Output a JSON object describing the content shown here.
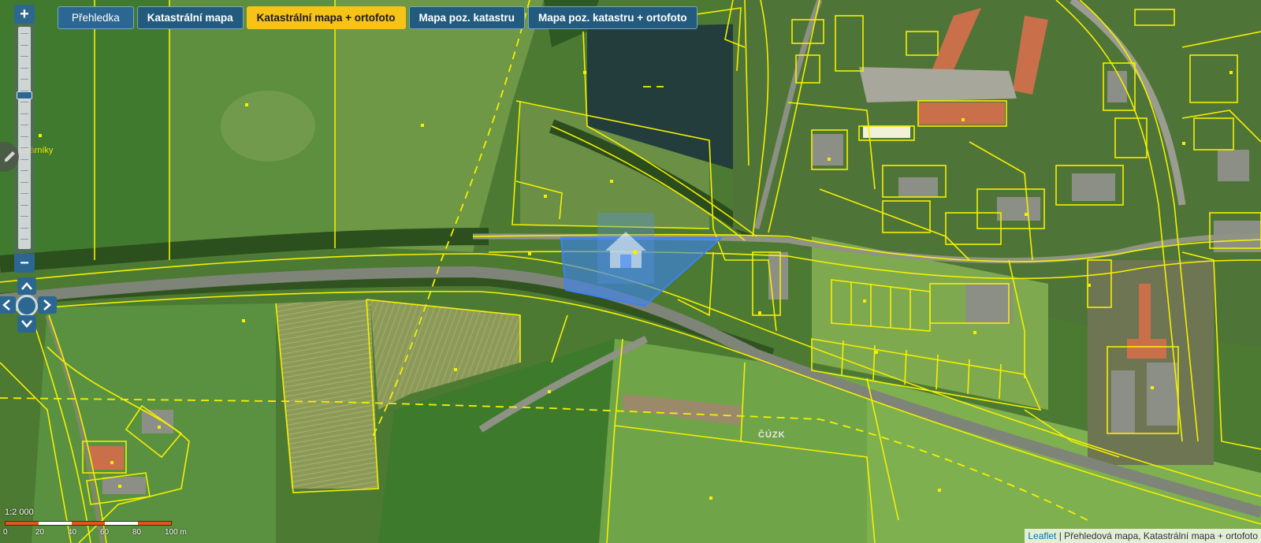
{
  "layers": {
    "overview": "Přehledka",
    "cadastral": "Katastrální mapa",
    "cadastral_ortho": "Katastrální mapa + ortofoto",
    "pos_cadastre": "Mapa poz. katastru",
    "pos_cadastre_ortho": "Mapa poz. katastru + ortofoto",
    "active": "cadastral_ortho"
  },
  "controls": {
    "zoom_in": "+",
    "zoom_out": "−",
    "zoom_level_fraction": 0.7,
    "icons": [
      "pencil-icon",
      "chevron-up-icon",
      "chevron-left-icon",
      "chevron-right-icon",
      "chevron-down-icon",
      "locate-icon",
      "house-marker-icon"
    ]
  },
  "scale": {
    "ratio": "1:2 000",
    "labels": [
      "0",
      "20",
      "40",
      "60",
      "80",
      "100 m"
    ]
  },
  "map_labels": {
    "place": "Žďárníky",
    "watermark": "ČÚZK"
  },
  "attribution": {
    "link": "Leaflet",
    "text": " | Přehledová mapa, Katastrální mapa + ortofoto"
  },
  "colors": {
    "parcel_line": "#f4f000",
    "highlight_parcel": "#3b82f6",
    "tab_active": "#f7c316",
    "tab_default": "#235b7e"
  }
}
